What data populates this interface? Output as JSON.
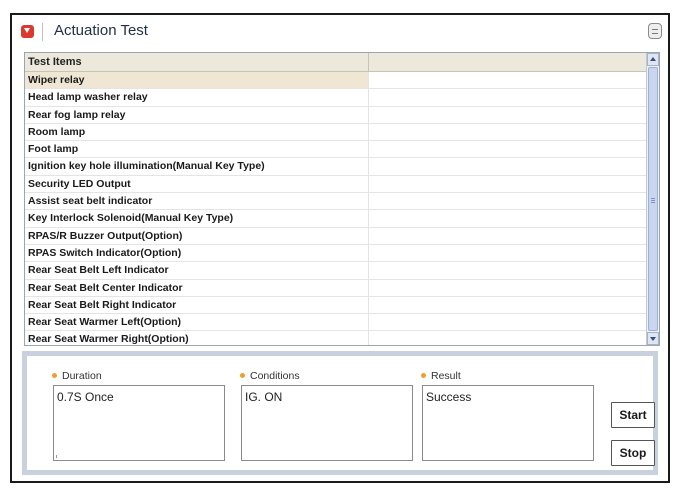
{
  "window": {
    "title": "Actuation Test"
  },
  "grid": {
    "header": "Test Items",
    "rows": [
      "Wiper relay",
      "Head lamp washer relay",
      "Rear fog lamp relay",
      "Room lamp",
      "Foot lamp",
      "Ignition key hole illumination(Manual Key Type)",
      "Security LED Output",
      "Assist seat belt indicator",
      "Key Interlock Solenoid(Manual Key Type)",
      "RPAS/R Buzzer Output(Option)",
      "RPAS Switch Indicator(Option)",
      "Rear Seat Belt Left Indicator",
      "Rear Seat Belt Center Indicator",
      "Rear Seat Belt Right Indicator",
      "Rear Seat Warmer Left(Option)",
      "Rear Seat Warmer Right(Option)"
    ],
    "selected_index": 0
  },
  "details": {
    "duration_label": "Duration",
    "duration_value": "0.7S Once",
    "conditions_label": "Conditions",
    "conditions_value": "IG. ON",
    "result_label": "Result",
    "result_value": "Success"
  },
  "buttons": {
    "start_label": "Start",
    "stop_label": "Stop"
  },
  "colors": {
    "accent": "#d9392e",
    "label_bullet": "#f0a02a",
    "selected_row": "#efe7d4"
  }
}
